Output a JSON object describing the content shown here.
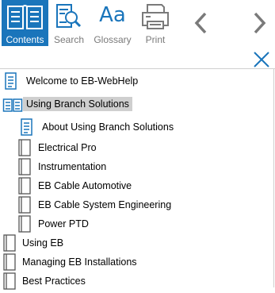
{
  "toolbar": {
    "contents_label": "Contents",
    "search_label": "Search",
    "glossary_label": "Glossary",
    "glossary_glyph": "Aa",
    "print_label": "Print",
    "accent": "#1a75bb"
  },
  "toc": {
    "items": [
      {
        "label": "Welcome to EB-WebHelp",
        "type": "page"
      },
      {
        "label": "Using Branch Solutions",
        "type": "open-book",
        "selected": true
      },
      {
        "label": "About Using Branch Solutions",
        "type": "page"
      },
      {
        "label": "Electrical Pro",
        "type": "book"
      },
      {
        "label": "Instrumentation",
        "type": "book"
      },
      {
        "label": "EB Cable Automotive",
        "type": "book"
      },
      {
        "label": "EB Cable System Engineering",
        "type": "book"
      },
      {
        "label": "Power PTD",
        "type": "book"
      },
      {
        "label": "Using EB",
        "type": "book"
      },
      {
        "label": "Managing EB Installations",
        "type": "book"
      },
      {
        "label": "Best Practices",
        "type": "book"
      }
    ]
  }
}
